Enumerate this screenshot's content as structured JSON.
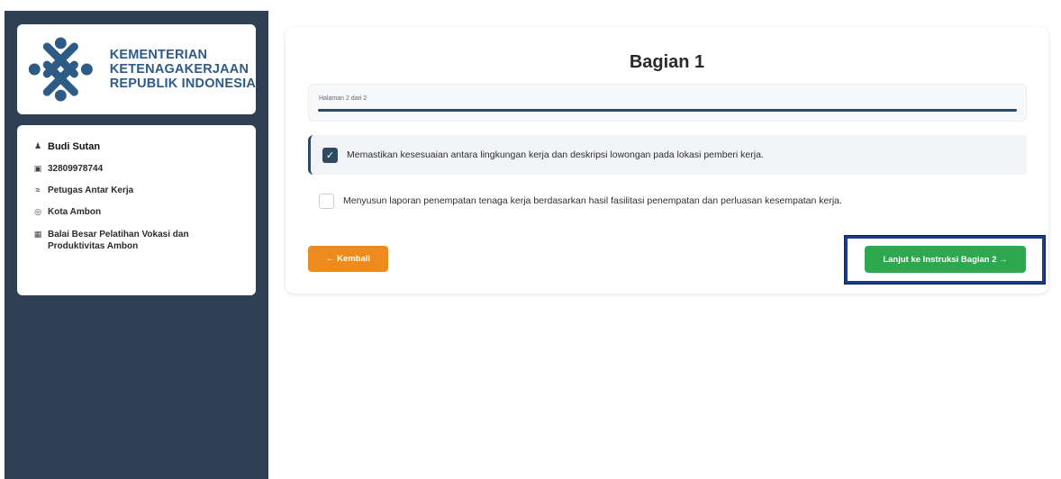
{
  "sidebar": {
    "logo": {
      "lines": [
        "KEMENTERIAN",
        "KETENAGAKERJAAN",
        "REPUBLIK INDONESIA"
      ],
      "icon": "ministry-emblem",
      "color": "#2e5a86"
    },
    "profile": {
      "name": "Budi Sutan",
      "id_number": "32809978744",
      "role": "Petugas Antar Kerja",
      "city": "Kota Ambon",
      "institution": "Balai Besar Pelatihan Vokasi dan Produktivitas Ambon",
      "icons": [
        "user-icon",
        "id-card-icon",
        "handshake-icon",
        "location-pin-icon",
        "building-icon"
      ]
    },
    "color": "#2f4055"
  },
  "main": {
    "title": "Bagian 1",
    "progress": {
      "text": "Halaman 2 dari 2",
      "value": 1.0
    },
    "tasks": [
      {
        "label": "Memastikan kesesuaian antara lingkungan kerja dan deskripsi lowongan pada lokasi pemberi kerja.",
        "checked": true
      },
      {
        "label": "Menyusun laporan penempatan tenaga kerja berdasarkan hasil fasilitasi penempatan dan perluasan kesempatan kerja.",
        "checked": false
      }
    ],
    "buttons": {
      "back": "← Kembali",
      "next": "Lanjut ke Instruksi Bagian 2 →"
    },
    "colors": {
      "accent": "#2e4a5e",
      "back": "#ee8b1f",
      "next": "#2ea84f",
      "highlight": "#1b3b8f"
    }
  }
}
